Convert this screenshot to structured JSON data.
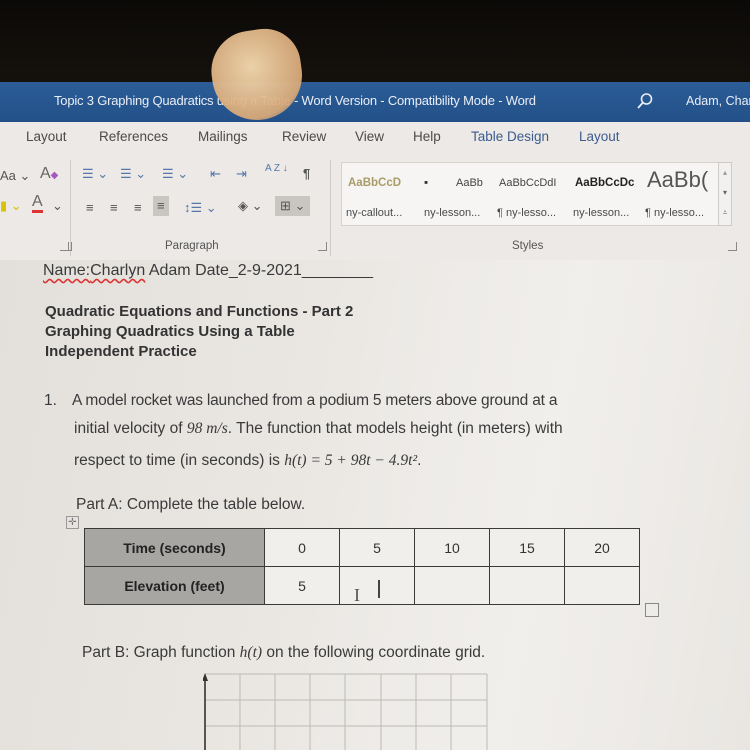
{
  "window": {
    "title": "Topic 3  Graphing Quadratics using a Table - Word Version  -  Compatibility Mode  -  Word",
    "user": "Adam, Char",
    "search_icon": "search-icon"
  },
  "ribbon": {
    "tabs": [
      {
        "label": "Layout"
      },
      {
        "label": "References"
      },
      {
        "label": "Mailings"
      },
      {
        "label": "Review"
      },
      {
        "label": "View"
      },
      {
        "label": "Help"
      },
      {
        "label": "Table Design"
      },
      {
        "label": "Layout"
      }
    ],
    "font_group": {
      "change_case_label": "Aa",
      "font_color_label": "A",
      "clear_format_label": "A"
    },
    "paragraph_group": {
      "label": "Paragraph",
      "pilcrow": "¶",
      "sort_label": "A Z"
    },
    "styles_group": {
      "label": "Styles",
      "styles": [
        {
          "sample": "AaBbCcD",
          "name": "ny-callout...",
          "color": "#a89c6a"
        },
        {
          "sample": "▪",
          "name": "ny-lesson...",
          "color": "#333333"
        },
        {
          "sample": "AaBb",
          "name": "",
          "color": "#444444"
        },
        {
          "sample": "AaBbCcDdI",
          "name": "¶ ny-lesso...",
          "color": "#444444"
        },
        {
          "sample": "AaBbCcDc",
          "name": "ny-lesson...",
          "color": "#222222"
        },
        {
          "sample": "AaBb(",
          "name": "¶ ny-lesso...",
          "color": "#555555"
        }
      ]
    }
  },
  "document": {
    "name_line": {
      "prefix": "Name:",
      "name_misspelled": "Charlyn",
      "rest": " Adam  Date_2-9-2021________"
    },
    "headings": [
      "Quadratic Equations and Functions - Part 2",
      "Graphing Quadratics Using a Table",
      "Independent Practice"
    ],
    "question": {
      "number": "1.",
      "line1": "A model rocket was launched from a podium 5 meters above ground at a",
      "line1_tail": "a",
      "line2_a": "initial velocity of ",
      "line2_math": "98 m/s",
      "line2_b": ".  The function that models height (in meters) with",
      "line3_a": "respect to time (in seconds) is ",
      "line3_math": "h(t) = 5 + 98t − 4.9t²",
      "line3_b": "."
    },
    "part_a": {
      "label": "Part A: Complete the table below.",
      "table": {
        "rows": [
          {
            "header": "Time (seconds)",
            "cells": [
              "0",
              "5",
              "10",
              "15",
              "20"
            ]
          },
          {
            "header": "Elevation (feet)",
            "cells": [
              "5",
              "",
              "",
              "",
              ""
            ]
          }
        ]
      }
    },
    "part_b": {
      "label_a": "Part B: Graph function ",
      "label_math": "h(t)",
      "label_b": " on the following coordinate grid."
    }
  }
}
